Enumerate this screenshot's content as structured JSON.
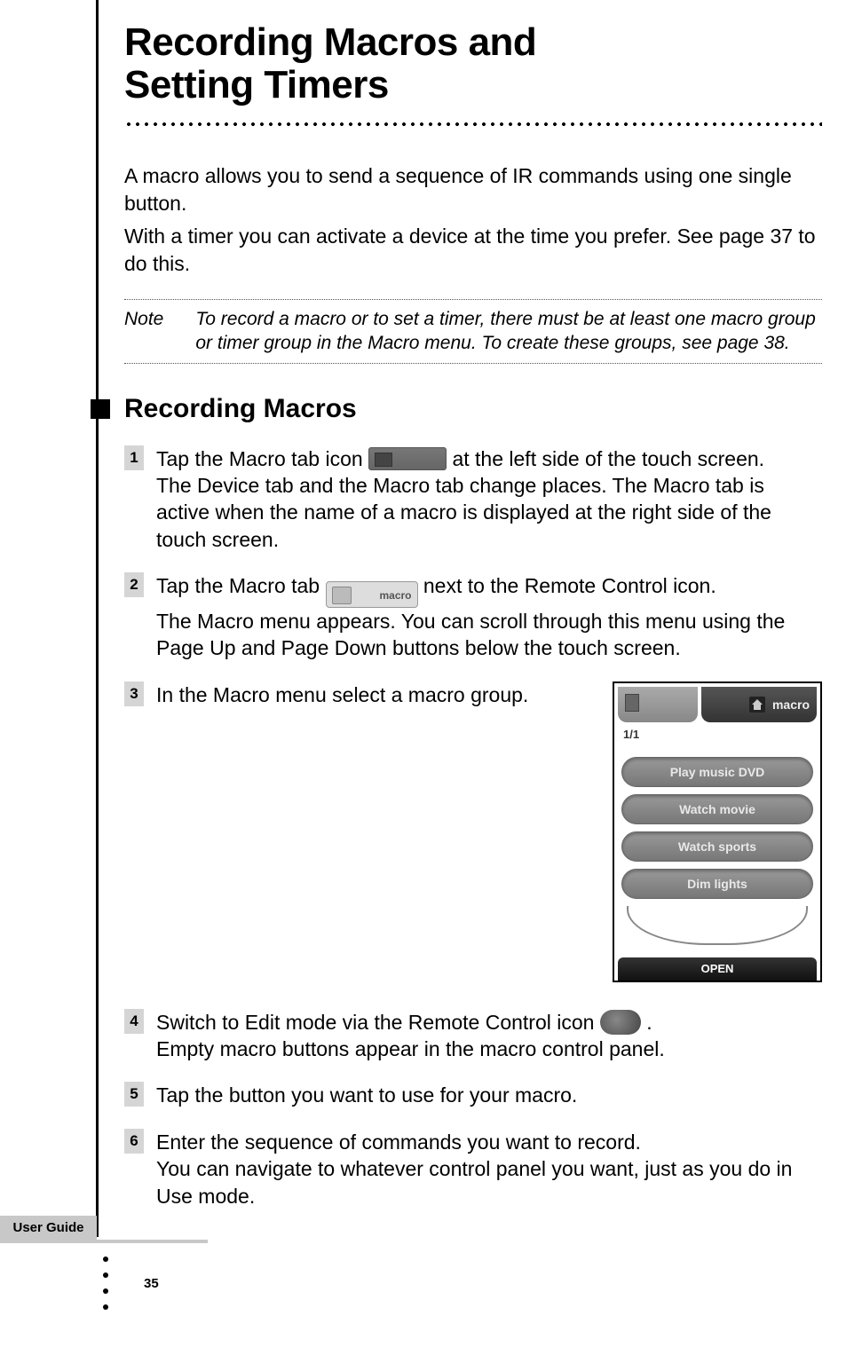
{
  "title_line1": "Recording Macros and",
  "title_line2": "Setting Timers",
  "intro": {
    "p1": "A macro allows you to send a sequence of IR commands using one single button.",
    "p2": "With a timer you can activate a device at the time you prefer. See page 37 to do this."
  },
  "note": {
    "label": "Note",
    "text": "To record a macro or to set a timer, there must be at least one macro group or timer group in the Macro menu. To create these groups, see page 38."
  },
  "section": {
    "heading": "Recording Macros"
  },
  "steps": {
    "s1": {
      "num": "1",
      "a": "Tap the Macro tab icon ",
      "b": " at the left side of the touch screen.",
      "sub": "The Device tab and the Macro tab change places. The Macro tab is active when the name of a macro is displayed at the right side of the touch screen."
    },
    "s2": {
      "num": "2",
      "a": "Tap the Macro tab ",
      "b": " next to the Remote Control icon.",
      "sub": "The Macro menu appears. You can scroll through this menu using the Page Up and Page Down buttons below the touch screen.",
      "iconLabel": "macro"
    },
    "s3": {
      "num": "3",
      "text": "In the Macro menu select a macro group."
    },
    "s4": {
      "num": "4",
      "a": "Switch to Edit mode via the Remote Control icon ",
      "b": ".",
      "sub": "Empty macro buttons appear in the macro control panel."
    },
    "s5": {
      "num": "5",
      "text": "Tap the button you want to use for your macro."
    },
    "s6": {
      "num": "6",
      "text": "Enter the sequence of commands you want to record.",
      "sub": "You can navigate to whatever control panel you want, just as you do in Use mode."
    }
  },
  "screenshot": {
    "tabLabel": "macro",
    "page": "1/1",
    "buttons": [
      "Play music DVD",
      "Watch movie",
      "Watch sports",
      "Dim lights"
    ],
    "open": "OPEN"
  },
  "footer": {
    "guide": "User Guide",
    "page": "35"
  }
}
